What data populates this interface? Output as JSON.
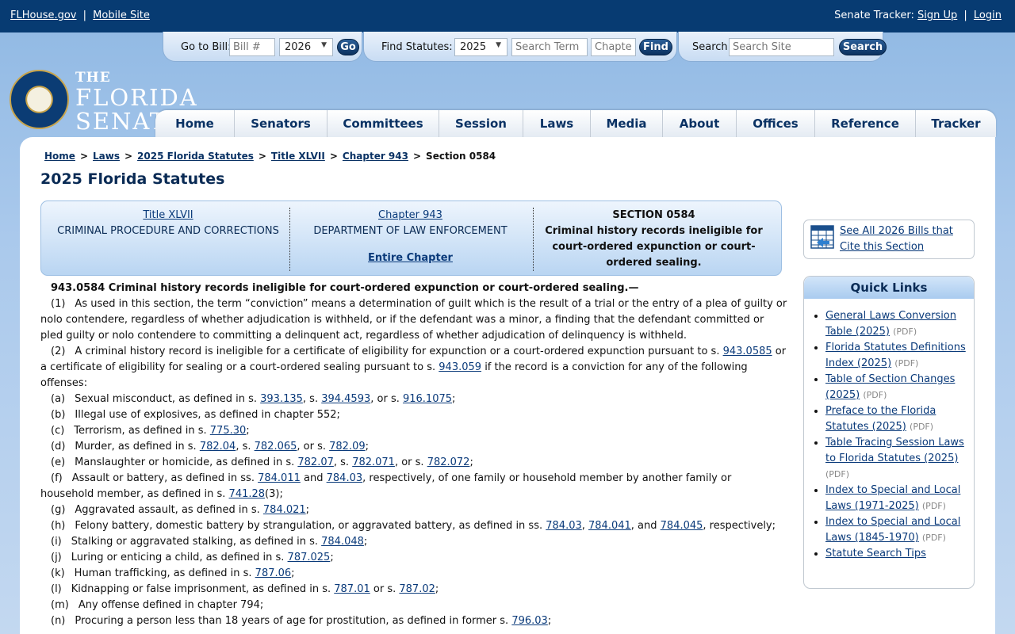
{
  "topbar": {
    "site_link": "FLHouse.gov",
    "separator": "|",
    "mobile_link": "Mobile Site",
    "tracker_label": "Senate Tracker:",
    "signup": "Sign Up",
    "login": "Login"
  },
  "tools": {
    "goto_label": "Go to Bill:",
    "bill_placeholder": "Bill #",
    "bill_year": "2026",
    "go_label": "Go",
    "find_label": "Find Statutes:",
    "statute_year": "2025",
    "search_term_placeholder": "Search Term",
    "chapter_placeholder": "Chapter",
    "find_button": "Find",
    "search_label": "Search",
    "search_placeholder": "Search Site",
    "search_button": "Search"
  },
  "logo": {
    "the": "THE",
    "line1": "FLORIDA",
    "line2": "SENATE"
  },
  "nav": [
    "Home",
    "Senators",
    "Committees",
    "Session",
    "Laws",
    "Media",
    "About",
    "Offices",
    "Reference",
    "Tracker"
  ],
  "breadcrumb": {
    "home": "Home",
    "laws": "Laws",
    "statutes": "2025 Florida Statutes",
    "title": "Title XLVII",
    "chapter": "Chapter 943",
    "current": "Section 0584",
    "gt": ">"
  },
  "page_title": "2025 Florida Statutes",
  "header": {
    "title_link": "Title XLVII",
    "title_desc": "CRIMINAL PROCEDURE AND CORRECTIONS",
    "chapter_link": "Chapter 943",
    "chapter_desc": "DEPARTMENT OF LAW ENFORCEMENT",
    "entire_chapter": "Entire Chapter",
    "section_label": "SECTION 0584",
    "section_desc": "Criminal history records ineligible for court-ordered expunction or court-ordered sealing."
  },
  "statute": {
    "title": "943.0584   Criminal history records ineligible for court-ordered expunction or court-ordered sealing.—",
    "p1_num": "(1)",
    "p1": "As used in this section, the term “conviction” means a determination of guilt which is the result of a trial or the entry of a plea of guilty or nolo contendere, regardless of whether adjudication is withheld, or if the defendant was a minor, a finding that the defendant committed or pled guilty or nolo contendere to committing a delinquent act, regardless of whether adjudication of delinquency is withheld.",
    "p2_num": "(2)",
    "p2a": "A criminal history record is ineligible for a certificate of eligibility for expunction or a court-ordered expunction pursuant to s.",
    "p2_link1": "943.0585",
    "p2b": "or a certificate of eligibility for sealing or a court-ordered sealing pursuant to s.",
    "p2_link2": "943.059",
    "p2c": "if the record is a conviction for any of the following offenses:",
    "a_num": "(a)",
    "a_text": "Sexual misconduct, as defined in s.",
    "a_l1": "393.135",
    "a_l2": "394.4593",
    "a_l3": "916.1075",
    "b_num": "(b)",
    "b_text": "Illegal use of explosives, as defined in chapter 552;",
    "c_num": "(c)",
    "c_text": "Terrorism, as defined in s.",
    "c_l1": "775.30",
    "d_num": "(d)",
    "d_text": "Murder, as defined in s.",
    "d_l1": "782.04",
    "d_l2": "782.065",
    "d_l3": "782.09",
    "e_num": "(e)",
    "e_text": "Manslaughter or homicide, as defined in s.",
    "e_l1": "782.07",
    "e_l2": "782.071",
    "e_l3": "782.072",
    "f_num": "(f)",
    "f_text": "Assault or battery, as defined in ss.",
    "f_l1": "784.011",
    "f_mid": "and",
    "f_l2": "784.03",
    "f_text2": ", respectively, of one family or household member by another family or household member, as defined in s.",
    "f_l3": "741.28",
    "f_end": "(3);",
    "g_num": "(g)",
    "g_text": "Aggravated assault, as defined in s.",
    "g_l1": "784.021",
    "h_num": "(h)",
    "h_text": "Felony battery, domestic battery by strangulation, or aggravated battery, as defined in ss.",
    "h_l1": "784.03",
    "h_l2": "784.041",
    "h_and": ", and",
    "h_l3": "784.045",
    "h_end": ", respectively;",
    "i_num": "(i)",
    "i_text": "Stalking or aggravated stalking, as defined in s.",
    "i_l1": "784.048",
    "j_num": "(j)",
    "j_text": "Luring or enticing a child, as defined in s.",
    "j_l1": "787.025",
    "k_num": "(k)",
    "k_text": "Human trafficking, as defined in s.",
    "k_l1": "787.06",
    "l_num": "(l)",
    "l_text": "Kidnapping or false imprisonment, as defined in s.",
    "l_l1": "787.01",
    "l_or": "or s.",
    "l_l2": "787.02",
    "m_num": "(m)",
    "m_text": "Any offense defined in chapter 794;",
    "n_num": "(n)",
    "n_text": "Procuring a person less than 18 years of age for prostitution, as defined in former s.",
    "n_l1": "796.03"
  },
  "sidebar": {
    "bills_link": "See All 2026 Bills that Cite this Section",
    "quick_title": "Quick Links",
    "pdf": "(PDF)",
    "links": [
      "General Laws Conversion Table (2025)",
      "Florida Statutes Definitions Index (2025)",
      "Table of Section Changes (2025)",
      "Preface to the Florida Statutes (2025)",
      "Table Tracing Session Laws to Florida Statutes (2025)",
      "Index to Special and Local Laws (1971-2025)",
      "Index to Special and Local Laws (1845-1970)",
      "Statute Search Tips"
    ]
  }
}
